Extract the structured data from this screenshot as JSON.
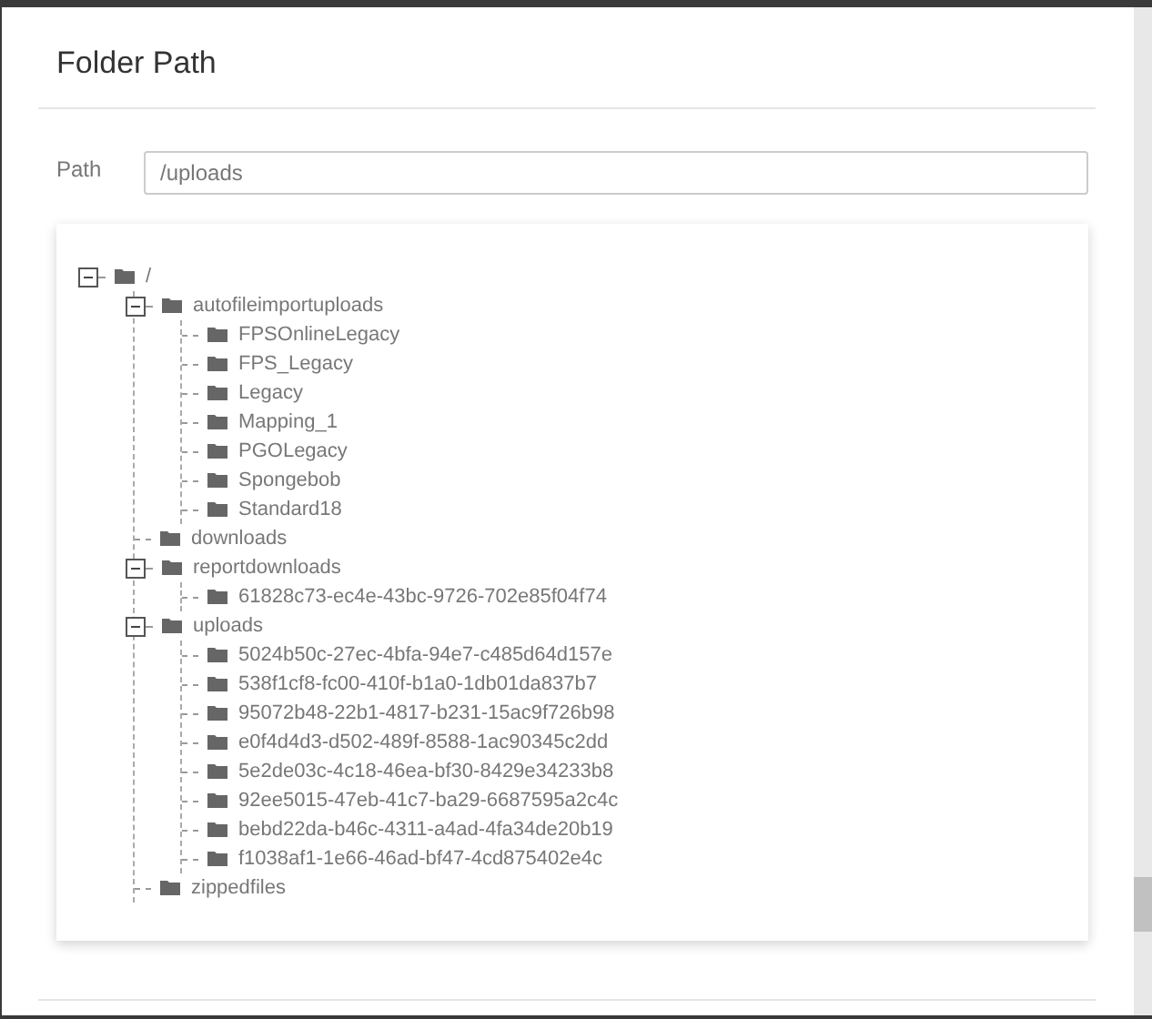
{
  "dialog": {
    "title": "Folder Path"
  },
  "path_field": {
    "label": "Path",
    "value": "/uploads"
  },
  "tree": [
    {
      "label": "/",
      "expanded": true,
      "children": [
        {
          "label": "autofileimportuploads",
          "expanded": true,
          "children": [
            {
              "label": "FPSOnlineLegacy"
            },
            {
              "label": "FPS_Legacy"
            },
            {
              "label": "Legacy"
            },
            {
              "label": "Mapping_1"
            },
            {
              "label": "PGOLegacy"
            },
            {
              "label": "Spongebob"
            },
            {
              "label": "Standard18"
            }
          ]
        },
        {
          "label": "downloads"
        },
        {
          "label": "reportdownloads",
          "expanded": true,
          "children": [
            {
              "label": "61828c73-ec4e-43bc-9726-702e85f04f74"
            }
          ]
        },
        {
          "label": "uploads",
          "expanded": true,
          "children": [
            {
              "label": "5024b50c-27ec-4bfa-94e7-c485d64d157e"
            },
            {
              "label": "538f1cf8-fc00-410f-b1a0-1db01da837b7"
            },
            {
              "label": "95072b48-22b1-4817-b231-15ac9f726b98"
            },
            {
              "label": "e0f4d4d3-d502-489f-8588-1ac90345c2dd"
            },
            {
              "label": "5e2de03c-4c18-46ea-bf30-8429e34233b8"
            },
            {
              "label": "92ee5015-47eb-41c7-ba29-6687595a2c4c"
            },
            {
              "label": "bebd22da-b46c-4311-a4ad-4fa34de20b19"
            },
            {
              "label": "f1038af1-1e66-46ad-bf47-4cd875402e4c"
            }
          ]
        },
        {
          "label": "zippedfiles"
        }
      ]
    }
  ]
}
